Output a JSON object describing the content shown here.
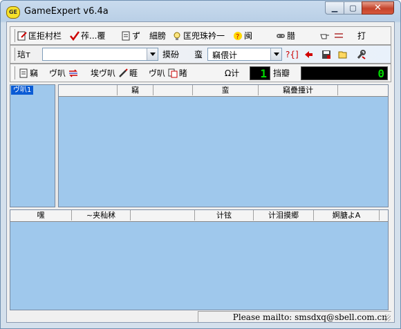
{
  "window": {
    "title": "GameExpert v6.4a",
    "app_icon_text": "GE",
    "min_icon": "minimize-icon",
    "max_icon": "maximize-icon",
    "close_glyph": "✕"
  },
  "toolbar1": {
    "item1": "匡拒村栏",
    "item2": "莋...覆",
    "item3": "ず",
    "item4": "細膀",
    "item5": "匡兜珠衿一",
    "item6": "闽",
    "item7": "腊",
    "item8": "打"
  },
  "toolbar2": {
    "label1": "琂т",
    "combo1_value": "",
    "label2": "摸砏",
    "label3": "蛮",
    "combo2_value": "竊偎计",
    "query_button": "?{]"
  },
  "toolbar3": {
    "item1": "竊",
    "item2": "ヴ叭",
    "item3": "埃ヴ叭",
    "item4": "睚",
    "item5": "ヴ叭",
    "item6": "睹",
    "label_count": "Ω计",
    "count_value": "1",
    "label_found": "挡瓣",
    "found_value": "0"
  },
  "tree": {
    "selected_item": "ヴ叭1"
  },
  "grid1": {
    "columns": [
      "",
      "竊",
      "",
      "蛮",
      "竊疊揰计",
      ""
    ]
  },
  "grid2": {
    "columns": [
      "嘿",
      "~夹秈秫",
      "",
      "计铉",
      "计泪摸郷",
      "婀膅よA"
    ]
  },
  "status": {
    "text": "Please mailto: smsdxq@sbell.com.cn"
  }
}
